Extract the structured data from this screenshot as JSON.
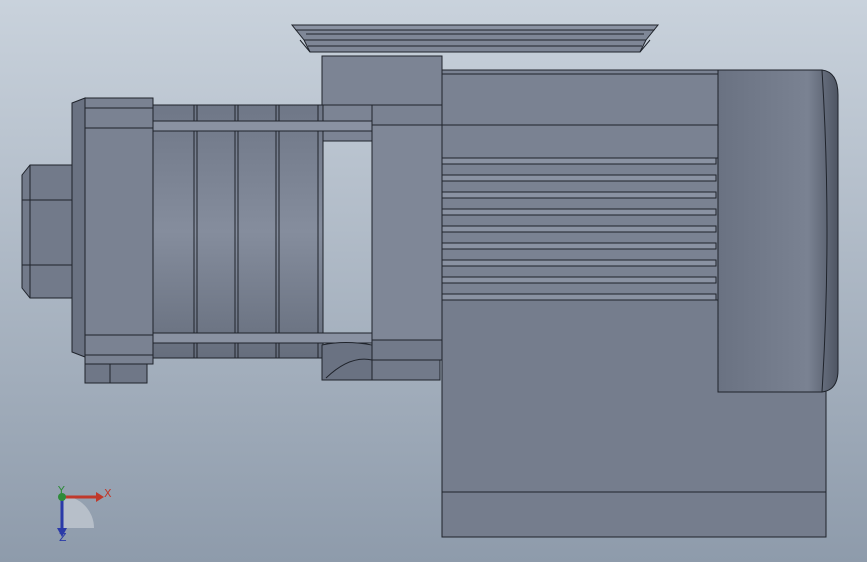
{
  "viewport": {
    "background_top": "#c9d2dc",
    "background_bottom": "#8e9bab",
    "body_color": "#737b8a",
    "body_light": "#8a92a2",
    "body_dark": "#5f6675",
    "edge_color": "#1f232b"
  },
  "triad": {
    "x_label": "X",
    "y_label": "Y",
    "z_label": "Z",
    "x_color": "#c0392b",
    "y_color": "#2e8b3a",
    "z_color": "#2a3aa8"
  }
}
